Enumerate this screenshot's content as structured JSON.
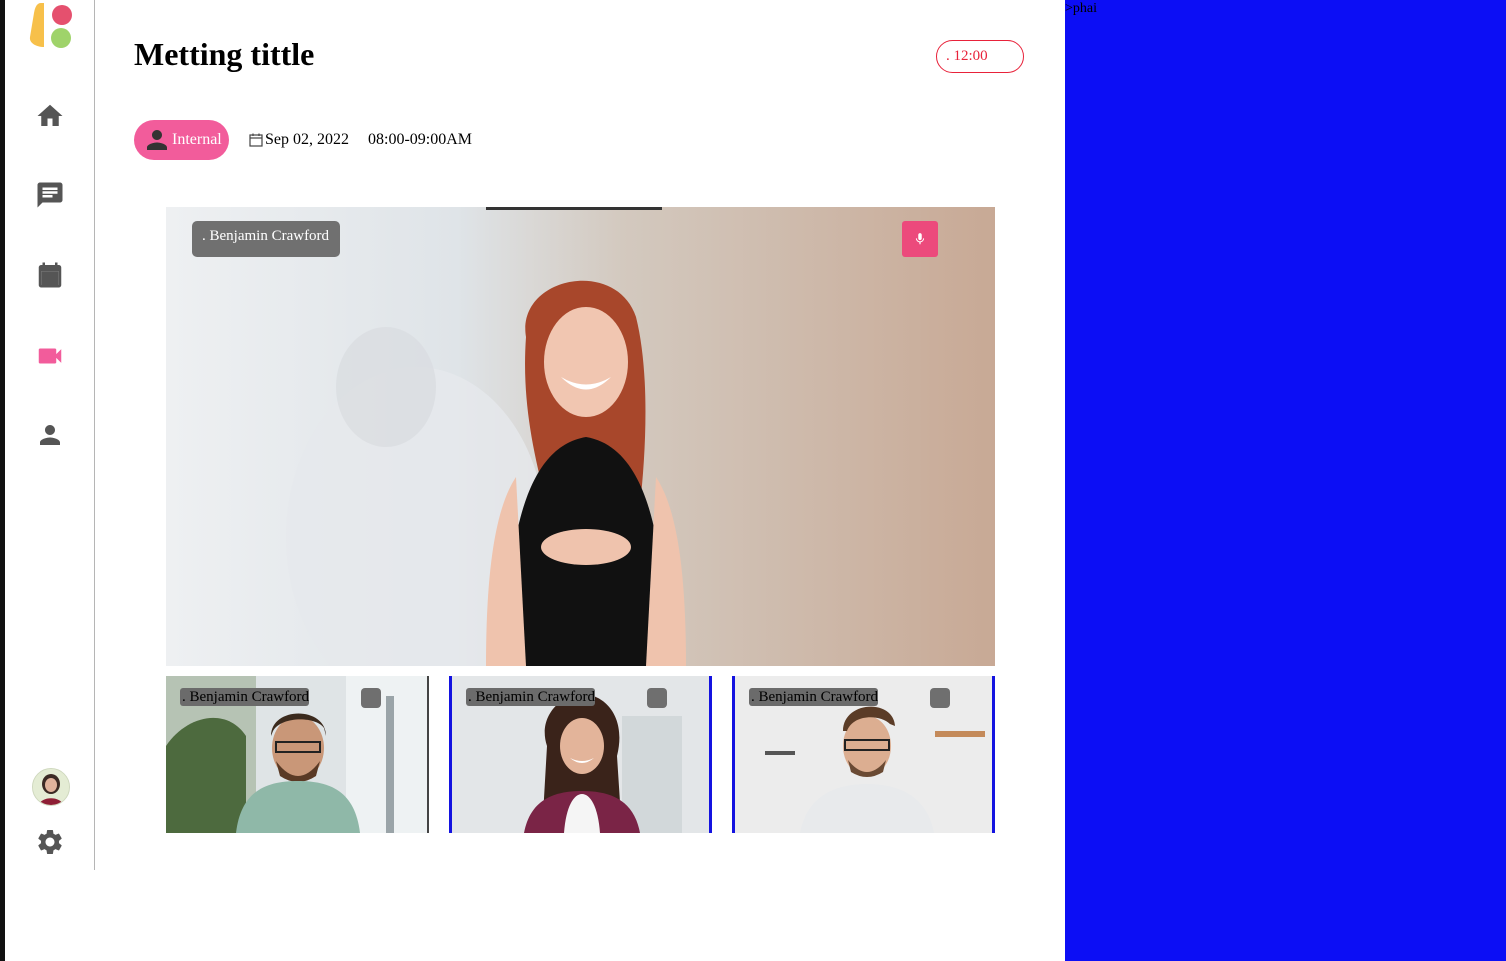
{
  "meeting": {
    "title": "Metting tittle",
    "timer": ". 12:00",
    "tag": "Internal",
    "date": "Sep 02, 2022",
    "time": "08:00-09:00AM"
  },
  "main_video": {
    "participant": ". Benjamin Crawford",
    "mic_icon": "mic-icon"
  },
  "tiles": [
    {
      "participant": ". Benjamin Crawford"
    },
    {
      "participant": ". Benjamin Crawford"
    },
    {
      "participant": ". Benjamin Crawford"
    }
  ],
  "sidebar": {
    "items": [
      {
        "icon": "home-icon"
      },
      {
        "icon": "chat-icon"
      },
      {
        "icon": "calendar-icon"
      },
      {
        "icon": "video-icon",
        "active": true
      },
      {
        "icon": "person-icon"
      }
    ],
    "settings_icon": "gear-icon"
  },
  "right_panel": {
    "text": ">phai"
  },
  "colors": {
    "accent": "#f25c9b",
    "timer": "#e8223a",
    "right_panel": "#0c0ef5",
    "icon": "#555555"
  }
}
